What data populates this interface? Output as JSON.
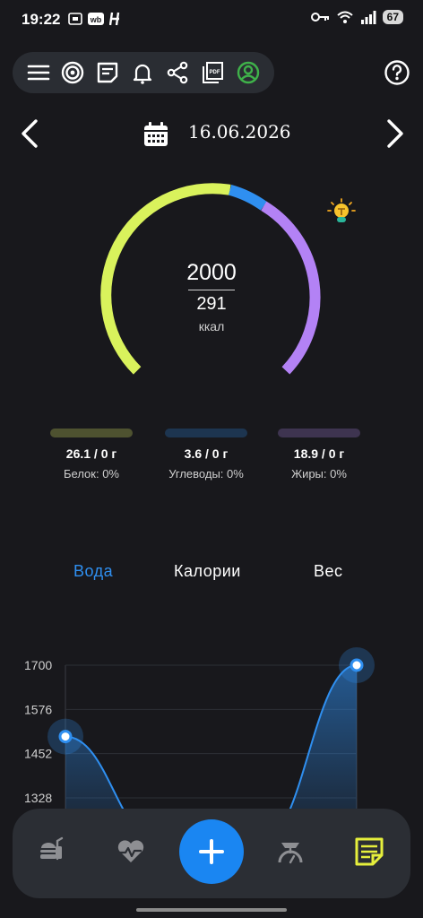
{
  "status_bar": {
    "time": "19:22",
    "icons": [
      "screenshot-icon",
      "wb-icon",
      "h-app-icon"
    ],
    "right_icons": [
      "key-icon",
      "wifi-icon",
      "signal-icon"
    ],
    "battery": "67"
  },
  "toolbar": {
    "icons": [
      "menu-icon",
      "target-icon",
      "notes-icon",
      "bell-icon",
      "share-icon",
      "pdf-icon",
      "profile-icon"
    ],
    "help_icon": "help-icon"
  },
  "date_nav": {
    "date": "16.06.2026",
    "prev_icon": "chevron-left-icon",
    "next_icon": "chevron-right-icon",
    "calendar_icon": "calendar-icon"
  },
  "calories": {
    "goal": "2000",
    "consumed": "291",
    "unit": "ккал",
    "segment_colors": [
      "#d9f25c",
      "#2f8ff0",
      "#b382f5"
    ]
  },
  "macros": [
    {
      "value": "26.1 / 0 г",
      "label": "Белок: 0%",
      "color": "#4e5230"
    },
    {
      "value": "3.6 / 0 г",
      "label": "Углеводы: 0%",
      "color": "#1d3550"
    },
    {
      "value": "18.9 / 0 г",
      "label": "Жиры: 0%",
      "color": "#3e3450"
    }
  ],
  "tabs": [
    {
      "label": "Вода",
      "active": true
    },
    {
      "label": "Калории",
      "active": false
    },
    {
      "label": "Вес",
      "active": false
    }
  ],
  "chart_data": {
    "type": "area",
    "y_ticks": [
      "1700",
      "1576",
      "1452",
      "1328"
    ],
    "ylim": [
      1328,
      1700
    ],
    "values": [
      1500,
      1200,
      1200,
      1700
    ],
    "color": "#2f8ff0"
  },
  "bottom_nav": {
    "items": [
      "food-icon",
      "heart-rate-icon",
      "add-icon",
      "scale-icon",
      "diary-icon"
    ],
    "active_color": "#e6ef3c"
  }
}
